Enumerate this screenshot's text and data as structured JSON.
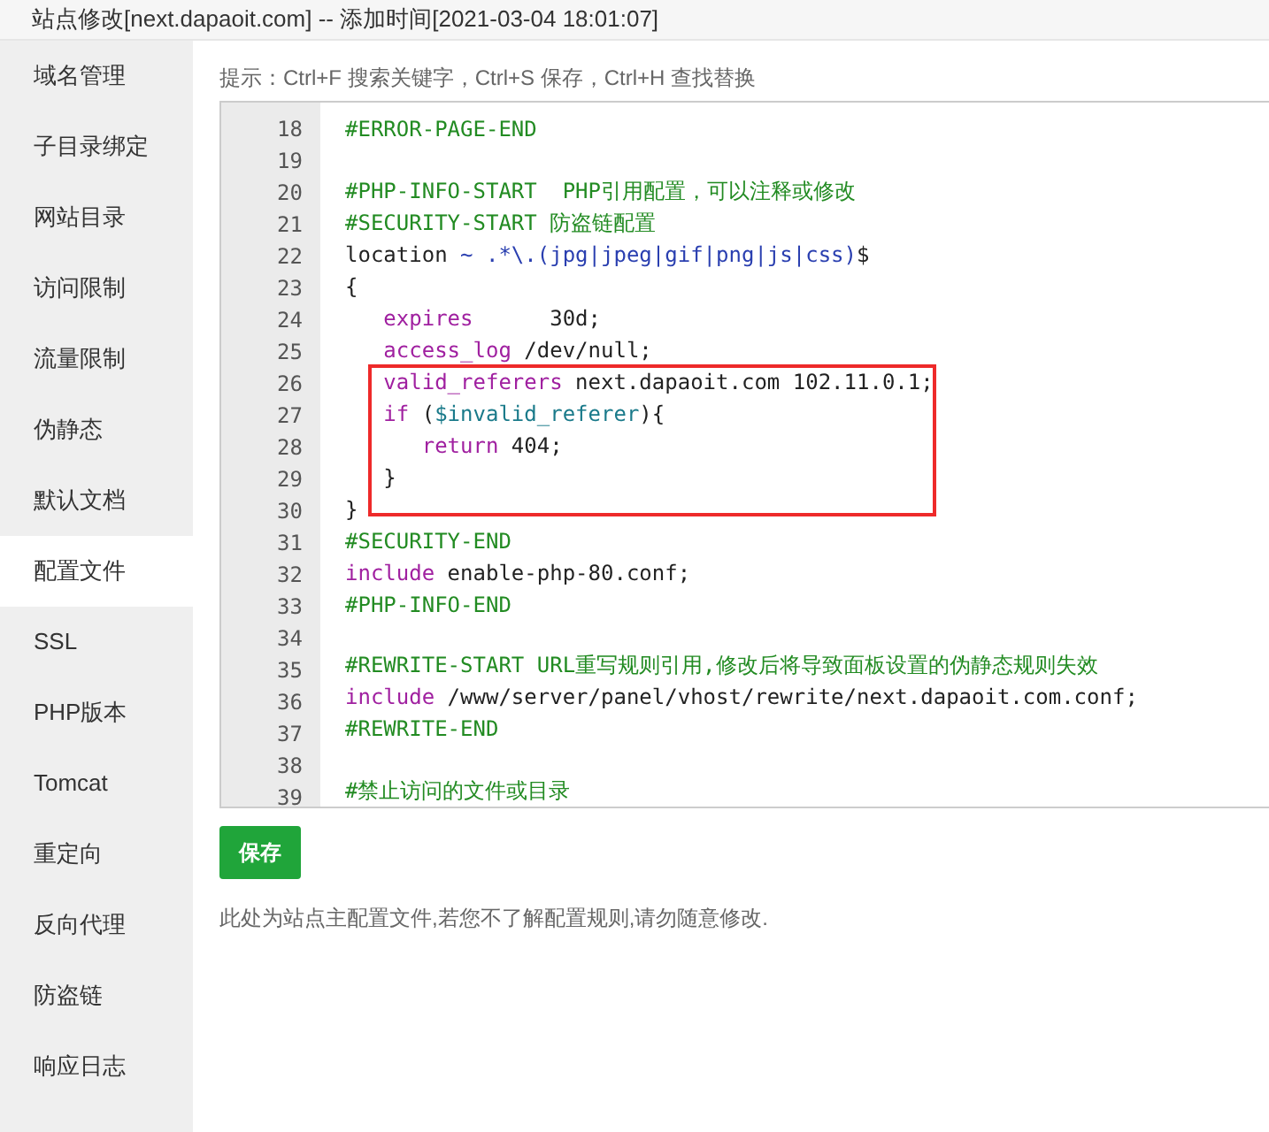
{
  "window": {
    "title": "站点修改[next.dapaoit.com] -- 添加时间[2021-03-04 18:01:07]"
  },
  "sidebar": {
    "items": [
      {
        "label": "域名管理",
        "selected": false
      },
      {
        "label": "子目录绑定",
        "selected": false
      },
      {
        "label": "网站目录",
        "selected": false
      },
      {
        "label": "访问限制",
        "selected": false
      },
      {
        "label": "流量限制",
        "selected": false
      },
      {
        "label": "伪静态",
        "selected": false
      },
      {
        "label": "默认文档",
        "selected": false
      },
      {
        "label": "配置文件",
        "selected": true
      },
      {
        "label": "SSL",
        "selected": false
      },
      {
        "label": "PHP版本",
        "selected": false
      },
      {
        "label": "Tomcat",
        "selected": false
      },
      {
        "label": "重定向",
        "selected": false
      },
      {
        "label": "反向代理",
        "selected": false
      },
      {
        "label": "防盗链",
        "selected": false
      },
      {
        "label": "响应日志",
        "selected": false
      }
    ]
  },
  "hint": "提示：Ctrl+F 搜索关键字，Ctrl+S 保存，Ctrl+H 查找替换",
  "editor": {
    "lines": [
      {
        "number": "18",
        "tokens": [
          {
            "kind": "comment",
            "text": "#ERROR-PAGE-END"
          }
        ]
      },
      {
        "number": "19"
      },
      {
        "number": "20",
        "tokens": [
          {
            "kind": "comment",
            "text": "#PHP-INFO-START  PHP引用配置，可以注释或修改"
          }
        ]
      },
      {
        "number": "21",
        "tokens": [
          {
            "kind": "comment",
            "text": "#SECURITY-START 防盗链配置"
          }
        ]
      },
      {
        "number": "22",
        "tokens": [
          {
            "kind": "plain",
            "text": "location "
          },
          {
            "kind": "string",
            "text": "~ .*\\.(jpg|jpeg|gif|png|js|css)"
          },
          {
            "kind": "plain",
            "text": "$"
          }
        ]
      },
      {
        "number": "23",
        "tokens": [
          {
            "kind": "plain",
            "text": "{"
          }
        ]
      },
      {
        "number": "24",
        "tokens": [
          {
            "kind": "keyword",
            "text": "   expires"
          },
          {
            "kind": "plain",
            "text": "      30d;"
          }
        ]
      },
      {
        "number": "25",
        "tokens": [
          {
            "kind": "keyword",
            "text": "   access_log"
          },
          {
            "kind": "plain",
            "text": " /dev/null;"
          }
        ]
      },
      {
        "number": "26",
        "tokens": [
          {
            "kind": "keyword",
            "text": "   valid_referers"
          },
          {
            "kind": "plain",
            "text": " next.dapaoit.com 102.11.0.1;"
          }
        ]
      },
      {
        "number": "27",
        "tokens": [
          {
            "kind": "keyword",
            "text": "   if"
          },
          {
            "kind": "plain",
            "text": " ("
          },
          {
            "kind": "variable",
            "text": "$invalid_referer"
          },
          {
            "kind": "plain",
            "text": "){"
          }
        ]
      },
      {
        "number": "28",
        "tokens": [
          {
            "kind": "keyword",
            "text": "      return"
          },
          {
            "kind": "plain",
            "text": " 404;"
          }
        ]
      },
      {
        "number": "29",
        "tokens": [
          {
            "kind": "plain",
            "text": "   }"
          }
        ]
      },
      {
        "number": "30",
        "tokens": [
          {
            "kind": "plain",
            "text": "}"
          }
        ]
      },
      {
        "number": "31",
        "tokens": [
          {
            "kind": "comment",
            "text": "#SECURITY-END"
          }
        ]
      },
      {
        "number": "32",
        "tokens": [
          {
            "kind": "keyword",
            "text": "include"
          },
          {
            "kind": "plain",
            "text": " enable-php-80.conf;"
          }
        ]
      },
      {
        "number": "33",
        "tokens": [
          {
            "kind": "comment",
            "text": "#PHP-INFO-END"
          }
        ]
      },
      {
        "number": "34"
      },
      {
        "number": "35",
        "tokens": [
          {
            "kind": "comment",
            "text": "#REWRITE-START URL重写规则引用,修改后将导致面板设置的伪静态规则失效"
          }
        ]
      },
      {
        "number": "36",
        "tokens": [
          {
            "kind": "keyword",
            "text": "include"
          },
          {
            "kind": "plain",
            "text": " /www/server/panel/vhost/rewrite/next.dapaoit.com.conf;"
          }
        ]
      },
      {
        "number": "37",
        "tokens": [
          {
            "kind": "comment",
            "text": "#REWRITE-END"
          }
        ]
      },
      {
        "number": "38"
      },
      {
        "number": "39",
        "tokens": [
          {
            "kind": "comment",
            "text": "#禁止访问的文件或目录"
          }
        ]
      }
    ]
  },
  "save_button": "保存",
  "note": "此处为站点主配置文件,若您不了解配置规则,请勿随意修改."
}
